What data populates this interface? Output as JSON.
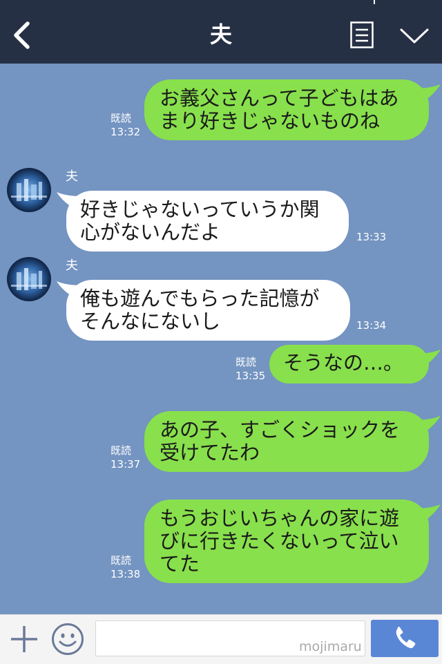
{
  "header": {
    "title": "夫",
    "back_icon": "chevron-left-icon",
    "menu_icon": "notes-menu-icon",
    "expand_icon": "chevron-down-icon"
  },
  "messages": [
    {
      "from": "me",
      "text": "お義父さんって子どもはあ\nまり好きじゃないものね",
      "read": "既読",
      "time": "13:32"
    },
    {
      "from": "夫",
      "text": "好きじゃないっていうか関\n心がないんだよ",
      "time": "13:33"
    },
    {
      "from": "夫",
      "text": "俺も遊んでもらった記憶が\nそんなにないし",
      "time": "13:34"
    },
    {
      "from": "me",
      "text": "そうなの…。",
      "read": "既読",
      "time": "13:35"
    },
    {
      "from": "me",
      "text": "あの子、すごくショックを\n受けてたわ",
      "read": "既読",
      "time": "13:37"
    },
    {
      "from": "me",
      "text": "もうおじいちゃんの家に遊\nびに行きたくないって泣い\nてた",
      "read": "既読",
      "time": "13:38"
    }
  ],
  "input": {
    "placeholder": "",
    "watermark": "mojimaru"
  },
  "colors": {
    "background": "#7494c1",
    "header": "#263045",
    "my_bubble": "#88e04c",
    "their_bubble": "#ffffff",
    "call_button": "#5a86d6"
  },
  "icons": {
    "plus": "plus-icon",
    "sticker": "smiley-icon",
    "call": "phone-icon"
  }
}
